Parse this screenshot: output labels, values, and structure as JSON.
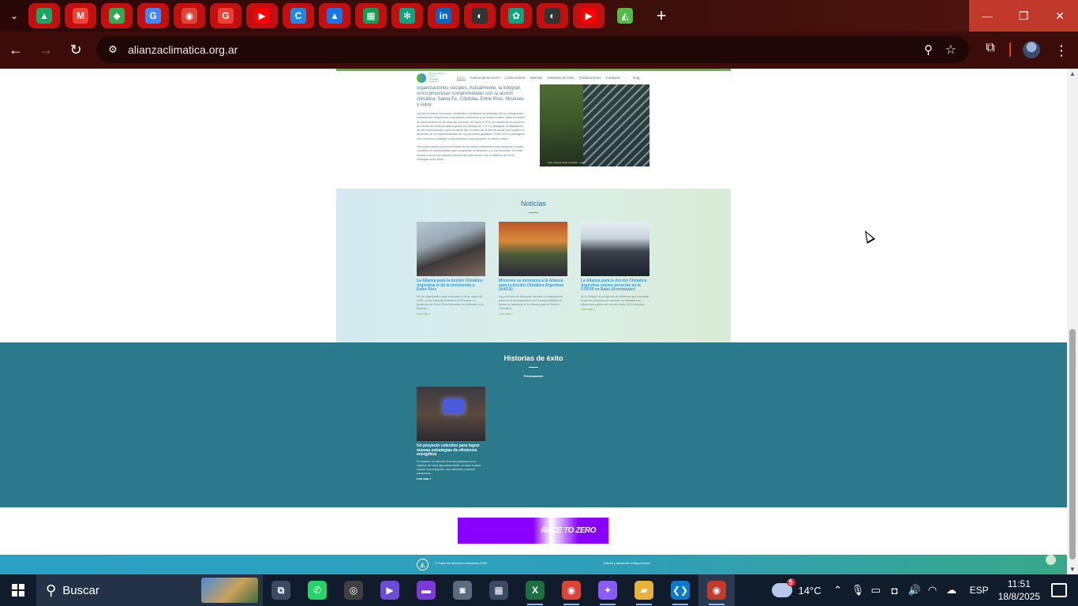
{
  "browser": {
    "tabs": [
      {
        "name": "google-drive-tab",
        "glyph": "▲",
        "color": "#1fa463"
      },
      {
        "name": "gmail-tab",
        "glyph": "M",
        "color": "#ea4335"
      },
      {
        "name": "google-maps-tab",
        "glyph": "◆",
        "color": "#34a853"
      },
      {
        "name": "google-translate-tab",
        "glyph": "G",
        "color": "#4285f4"
      },
      {
        "name": "chrome-tab",
        "glyph": "◉",
        "color": "#db4437"
      },
      {
        "name": "google-search-tab",
        "glyph": "G",
        "color": "#ea4335"
      },
      {
        "name": "youtube-tab",
        "glyph": "▶",
        "color": "#ff0000"
      },
      {
        "name": "classroom-tab",
        "glyph": "C",
        "color": "#1e88e5"
      },
      {
        "name": "ads-tab",
        "glyph": "▲",
        "color": "#1a73e8"
      },
      {
        "name": "sheets-tab",
        "glyph": "▦",
        "color": "#0f9d58"
      },
      {
        "name": "openai-tab",
        "glyph": "✻",
        "color": "#10a37f"
      },
      {
        "name": "linkedin-tab",
        "glyph": "in",
        "color": "#0a66c2"
      },
      {
        "name": "github-tab",
        "glyph": "◐",
        "color": "#333333"
      },
      {
        "name": "chatgpt-tab",
        "glyph": "✿",
        "color": "#10a37f"
      },
      {
        "name": "github-tab-2",
        "glyph": "◐",
        "color": "#333333"
      },
      {
        "name": "youtube-tab-2",
        "glyph": "▶",
        "color": "#ff0000"
      },
      {
        "name": "alianza-tab",
        "glyph": "◭",
        "color": "#54b948",
        "active": true
      }
    ],
    "url": "alianzaclimatica.org.ar"
  },
  "site": {
    "nav": {
      "logo_text": "Alianza para la Acción Climática Argentina",
      "links": [
        "Inicio",
        "Acerca de la AACA",
        "Cómo unirse",
        "Noticias",
        "Historias de éxito",
        "Publicaciones",
        "Contacto",
        "···",
        "Eng"
      ]
    },
    "intro": {
      "lead": "organizaciones sociales. Actualmente, la integran cinco provincias comprometidas con la acción climática: Santa Fe, Córdoba, Entre Ríos, Misiones y Jujuy.",
      "para1": "La AACA busca reconocer, visibilizar y multiplicar la actividad de sus integrantes, movilizando, integrando y escalando esfuerzos y acciones locales, para contribuir al cumplimiento de la meta del Acuerdo de París (1.5ºC) de mantener el aumento promedio de la temperatura global por debajo de 1,5°C y asegurar la adaptación de las comunidades, para construir así a través de la fuerza social que supone la ambición de la implementación de los acuerdos globales. ¡Este nuevo paradigma nos convoca a trabajar conjuntamente para alcanzar un futuro mejor!",
      "para2": "Nos proponemos promover todas las acciones existentes para canalizar la tarea climática en comunidades que compartan la ambición y el compromiso. En este sentido sumar los mejores actores de cada sector con el objetivo de tener sinergias entre ellos.",
      "photo_caption": "Foto: Parque Solar Cauchari · Jujuy"
    },
    "news": {
      "title": "Noticias",
      "cards": [
        {
          "title": "La Alianza para la Acción Climática Argentina le da la bienvenida a Entre Ríos",
          "excerpt": "En un significativo acto realizado el 8 de mayo de 2025, en la Casa de Gobierno de Paraná, la provincia de Entre Ríos formalizó su adhesión a la Alianza...",
          "more": "Leer más »"
        },
        {
          "title": "Misiones se incorpora a la Alianza para la Acción Climática Argentina (AACA)",
          "excerpt": "La provincia de Misiones ha dado un importante paso en su compromiso con la sostenibilidad al firmar su adhesión a la Alianza para la Acción Climática...",
          "more": "Leer más »"
        },
        {
          "title": "La Alianza para la Acción Climática Argentina estuvo presente en la COP29 en Bakú (Azerbaiyán)",
          "excerpt": "ACA Global, la red global de Alianzas que impulsan la acción climática de actores no estatales en diferentes partes del mundo, este 2024 impulsó...",
          "more": "Leer más »"
        }
      ]
    },
    "historias": {
      "title": "Historias de éxito",
      "subtitle": "Próximamente",
      "card": {
        "title": "Un proyecto colectivo para lograr nuevas estrategias de eficiencia energética",
        "excerpt": "El objetivo es difundir buenas prácticas en la cadena de valor agroalimentaria, no sólo a favor reducir sus impactos, sino también a reducir consumos...",
        "more": "Leer más »"
      }
    },
    "banner": {
      "text": "RACE TO ZERO"
    },
    "footer": {
      "copyright": "© Todos los derechos reservados 2025",
      "credit": "Diseño y desarrollo: indigocomunic"
    }
  },
  "taskbar": {
    "search_placeholder": "Buscar",
    "apps": [
      {
        "name": "task-view-icon",
        "glyph": "⧉",
        "color": "#3a4a62"
      },
      {
        "name": "whatsapp-icon",
        "glyph": "✆",
        "color": "#25d366"
      },
      {
        "name": "obs-icon",
        "glyph": "◎",
        "color": "#404040"
      },
      {
        "name": "media-player-icon",
        "glyph": "▶",
        "color": "#6a4cd6"
      },
      {
        "name": "clipchamp-icon",
        "glyph": "▬",
        "color": "#7a3ad6"
      },
      {
        "name": "camera-icon",
        "glyph": "◙",
        "color": "#5c6a80"
      },
      {
        "name": "calculator-icon",
        "glyph": "▦",
        "color": "#3a4a62"
      },
      {
        "name": "excel-icon",
        "glyph": "X",
        "color": "#1d6f42"
      },
      {
        "name": "chrome-icon",
        "glyph": "◉",
        "color": "#db4437"
      },
      {
        "name": "copilot-icon",
        "glyph": "✦",
        "color": "#8a5cf6"
      },
      {
        "name": "file-explorer-icon",
        "glyph": "▰",
        "color": "#e8b13a"
      },
      {
        "name": "vscode-icon",
        "glyph": "❮❯",
        "color": "#0a7acc"
      },
      {
        "name": "chrome-profile-icon",
        "glyph": "◉",
        "color": "#c23a2a",
        "active": true
      }
    ],
    "weather": {
      "temp": "14°C",
      "badge": "5"
    },
    "language": "ESP",
    "time": "11:51",
    "date": "18/8/2025"
  }
}
